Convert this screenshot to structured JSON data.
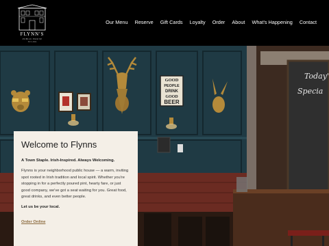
{
  "brand": {
    "name": "FLYNN'S",
    "subtitle": "PUBLIC HOUSE",
    "est": "EST. 2004"
  },
  "nav": [
    {
      "label": "Our Menu"
    },
    {
      "label": "Reserve"
    },
    {
      "label": "Gift Cards"
    },
    {
      "label": "Loyalty"
    },
    {
      "label": "Order"
    },
    {
      "label": "About"
    },
    {
      "label": "What's Happening"
    },
    {
      "label": "Contact"
    }
  ],
  "scene": {
    "sign_lines": [
      "GOOD",
      "PEOPLE",
      "DRINK",
      "GOOD",
      "BEER"
    ],
    "chalkboard_lines": [
      "Today's",
      "Specia"
    ]
  },
  "welcome": {
    "title": "Welcome to Flynns",
    "tagline": "A Town Staple. Irish-Inspired. Always Welcoming.",
    "body": "Flynns is your neighborhood public house — a warm, inviting spot rooted in Irish tradition and local spirit. Whether you're stopping in for a perfectly poured pint, hearty fare, or just good company, we've got a seat waiting for you. Great food, great drinks, and even better people.",
    "local": "Let us be your local.",
    "cta": "Order Online"
  },
  "colors": {
    "header_bg": "#000000",
    "wall": "#1f3a44",
    "card_bg": "#f4efe7",
    "accent": "#8b6a3d",
    "booth": "#6b2b22"
  }
}
